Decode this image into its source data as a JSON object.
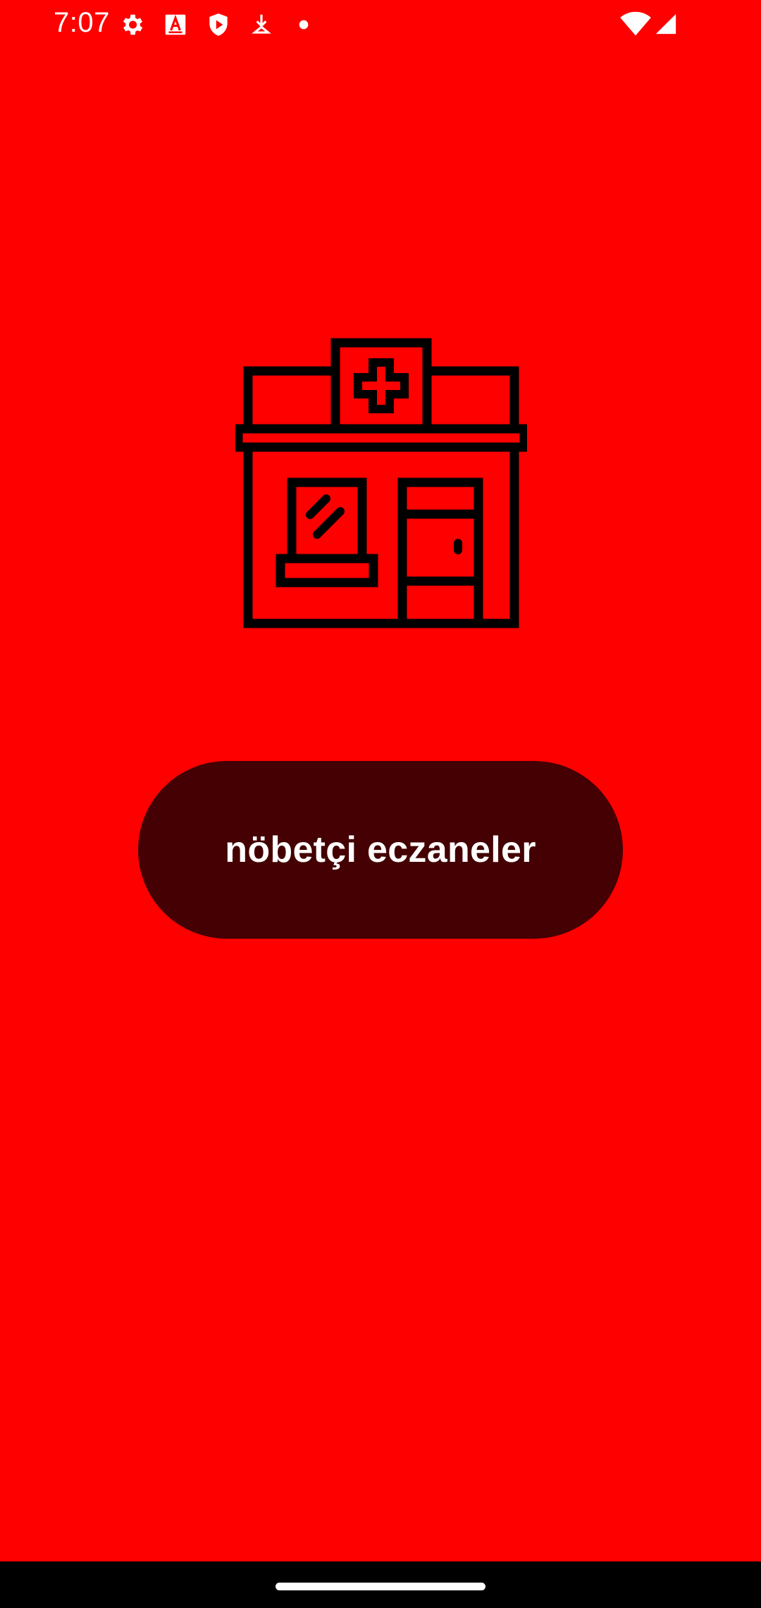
{
  "status_bar": {
    "time": "7:07",
    "icons": [
      "settings-icon",
      "font-icon",
      "shield-play-icon",
      "download-icon",
      "dot-icon",
      "wifi-icon",
      "signal-icon"
    ]
  },
  "main": {
    "illustration": "pharmacy-building-icon",
    "button_label": "nöbetçi eczaneler"
  },
  "colors": {
    "background": "#ff0000",
    "button": "#440002",
    "button_text": "#ffffff",
    "navigation_bar": "#000000"
  }
}
